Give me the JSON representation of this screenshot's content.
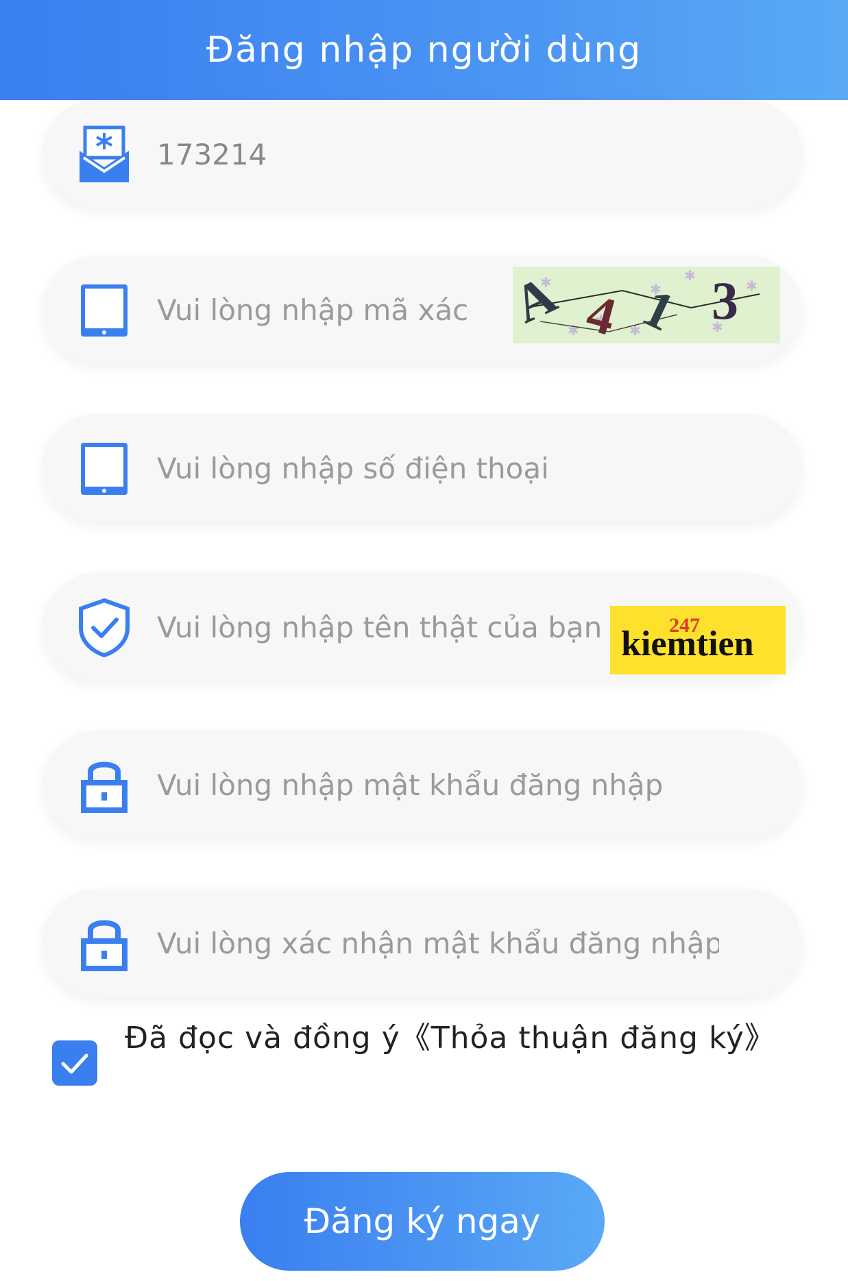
{
  "header": {
    "title": "Đăng nhập người dùng"
  },
  "form": {
    "fields": [
      {
        "icon": "envelope-snowflake-icon",
        "value": "173214",
        "placeholder": ""
      },
      {
        "icon": "tablet-icon",
        "value": "",
        "placeholder": "Vui lòng nhập mã xác minh"
      },
      {
        "icon": "tablet-icon",
        "value": "",
        "placeholder": "Vui lòng nhập số điện thoại"
      },
      {
        "icon": "shield-check-icon",
        "value": "",
        "placeholder": "Vui lòng nhập tên thật của bạn"
      },
      {
        "icon": "lock-icon",
        "value": "",
        "placeholder": "Vui lòng nhập mật khẩu đăng nhập"
      },
      {
        "icon": "lock-icon",
        "value": "",
        "placeholder": "Vui lòng xác nhận mật khẩu đăng nhập"
      }
    ],
    "captcha_text": "A 4 1 3",
    "watermark": {
      "number": "247",
      "word": "kiemtien"
    },
    "agree": {
      "checked": true,
      "text": "Đã đọc và đồng ý《Thỏa thuận đăng ký》"
    },
    "submit_label": "Đăng ký ngay"
  },
  "colors": {
    "primary": "#3a7ff0",
    "field_bg": "#f7f7f7",
    "watermark_bg": "#fde12d"
  }
}
